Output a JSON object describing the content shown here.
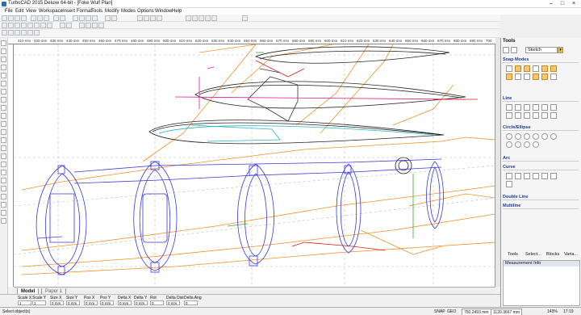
{
  "window": {
    "title": "TurboCAD 2015 Deluxe 64-bit - [Foke Wulf Plan]",
    "controls": [
      "–",
      "□",
      "×"
    ]
  },
  "menu": [
    "File",
    "Edit",
    "View",
    "Workspace",
    "Insert",
    "Format",
    "Tools",
    "Modify",
    "Modes",
    "Options",
    "Window",
    "Help"
  ],
  "ruler": {
    "top_ticks": [
      "410 mm",
      "420 mm",
      "430 mm",
      "440 mm",
      "450 mm",
      "460 mm",
      "470 mm",
      "480 mm",
      "490 mm",
      "500 mm",
      "510 mm",
      "520 mm",
      "530 mm",
      "540 mm",
      "550 mm",
      "560 mm",
      "570 mm",
      "580 mm",
      "590 mm",
      "600 mm",
      "610 mm",
      "620 mm",
      "630 mm",
      "640 mm",
      "650 mm",
      "660 mm",
      "670 mm",
      "680 mm",
      "690 mm",
      "700 mm"
    ]
  },
  "sheet_tabs": [
    "Model",
    "Paper 1"
  ],
  "inspector": {
    "fields": [
      {
        "label": "Scale X",
        "value": "1"
      },
      {
        "label": "Scale Y",
        "value": "1"
      },
      {
        "label": "Size X",
        "value": "0 mm"
      },
      {
        "label": "Size Y",
        "value": "0 mm"
      },
      {
        "label": "Pos X",
        "value": "0 mm"
      },
      {
        "label": "Pos Y",
        "value": "0 mm"
      },
      {
        "label": "Delta X",
        "value": "0 mm"
      },
      {
        "label": "Delta Y",
        "value": "0 mm"
      },
      {
        "label": "Rot",
        "value": "0"
      },
      {
        "label": "Delta Dist",
        "value": "0 mm"
      },
      {
        "label": "Delta Ang",
        "value": "0"
      }
    ]
  },
  "status": {
    "message": "Select object(s)",
    "snap": "SNAP",
    "geo": "GEO",
    "coord_x": "750.2493 mm",
    "coord_y": "1120.3667 mm",
    "zoom": "143%",
    "time": "17:19"
  },
  "tools_panel": {
    "title": "Tools",
    "mode": "Sketch",
    "sections": [
      "Snap Modes",
      "Line",
      "Circle/Ellipse",
      "Arc",
      "Curve",
      "Double Line",
      "Multiline"
    ],
    "bottom_tabs": [
      "Tools",
      "Select...",
      "Blocks",
      "Varia..."
    ],
    "measurement_title": "Measurement Info"
  },
  "colors": {
    "orange": "#f0902a",
    "blue": "#3a3ad8",
    "black": "#222222",
    "magenta": "#e01b8f",
    "cyan": "#26b5c4",
    "green": "#2fae2f",
    "red": "#d62020",
    "accent": "#1a3d8f"
  }
}
